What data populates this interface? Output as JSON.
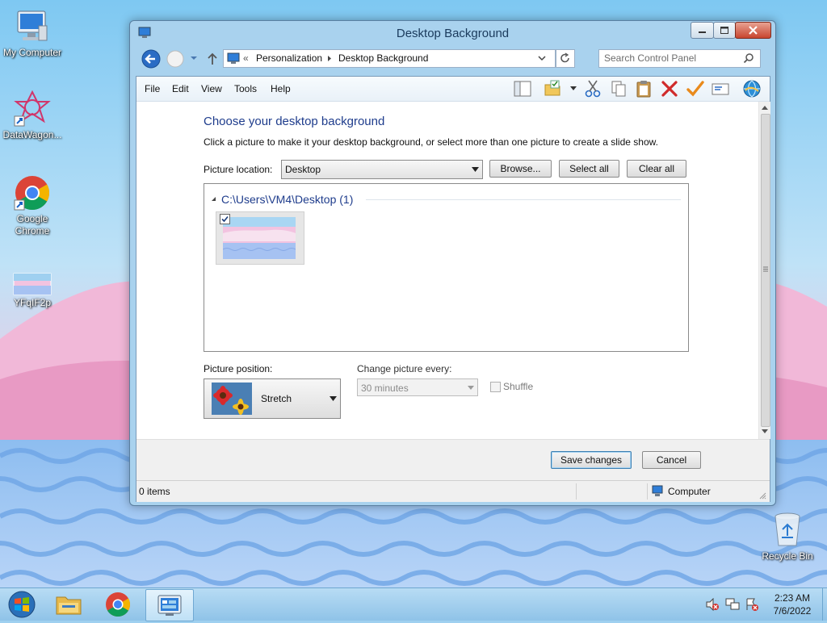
{
  "desktop": {
    "icons": [
      {
        "label": "My Computer",
        "icon": "computer-icon"
      },
      {
        "label": "DataWagon...",
        "icon": "datawagon-shortcut-icon"
      },
      {
        "label": "Google Chrome",
        "icon": "chrome-shortcut-icon"
      },
      {
        "label": "YFqIF2p",
        "icon": "image-file-icon"
      },
      {
        "label": "Recycle Bin",
        "icon": "recycle-bin-icon"
      }
    ]
  },
  "window": {
    "title": "Desktop Background",
    "address": {
      "overflow": "«",
      "crumbs": [
        "Personalization",
        "Desktop Background"
      ]
    },
    "search_placeholder": "Search Control Panel",
    "menu": [
      "File",
      "Edit",
      "View",
      "Tools",
      "Help"
    ],
    "toolbar_icons": [
      "layout-pane-icon",
      "folder-options-icon",
      "cut-icon",
      "copy-icon",
      "paste-icon",
      "delete-icon",
      "properties-check-icon",
      "email-icon",
      "internet-globe-icon"
    ]
  },
  "content": {
    "heading": "Choose your desktop background",
    "subtitle": "Click a picture to make it your desktop background, or select more than one picture to create a slide show.",
    "picture_location_label": "Picture location:",
    "picture_location_value": "Desktop",
    "browse_label": "Browse...",
    "select_all_label": "Select all",
    "clear_all_label": "Clear all",
    "group_title": "C:\\Users\\VM4\\Desktop (1)",
    "thumbnail_checked": true,
    "position_label": "Picture position:",
    "position_value": "Stretch",
    "interval_label": "Change picture every:",
    "interval_value": "30 minutes",
    "shuffle_label": "Shuffle",
    "save_label": "Save changes",
    "cancel_label": "Cancel"
  },
  "statusbar": {
    "items": "0 items",
    "zone": "Computer"
  },
  "taskbar": {
    "apps": [
      "explorer-icon",
      "chrome-icon",
      "control-panel-icon"
    ],
    "time": "2:23 AM",
    "date": "7/6/2022",
    "tray_icons": [
      "volume-muted-icon",
      "network-icon",
      "action-center-icon"
    ]
  },
  "colors": {
    "accent": "#1f4e8c",
    "heading": "#1e3c8c",
    "window_frame": "#a9d2ee"
  }
}
